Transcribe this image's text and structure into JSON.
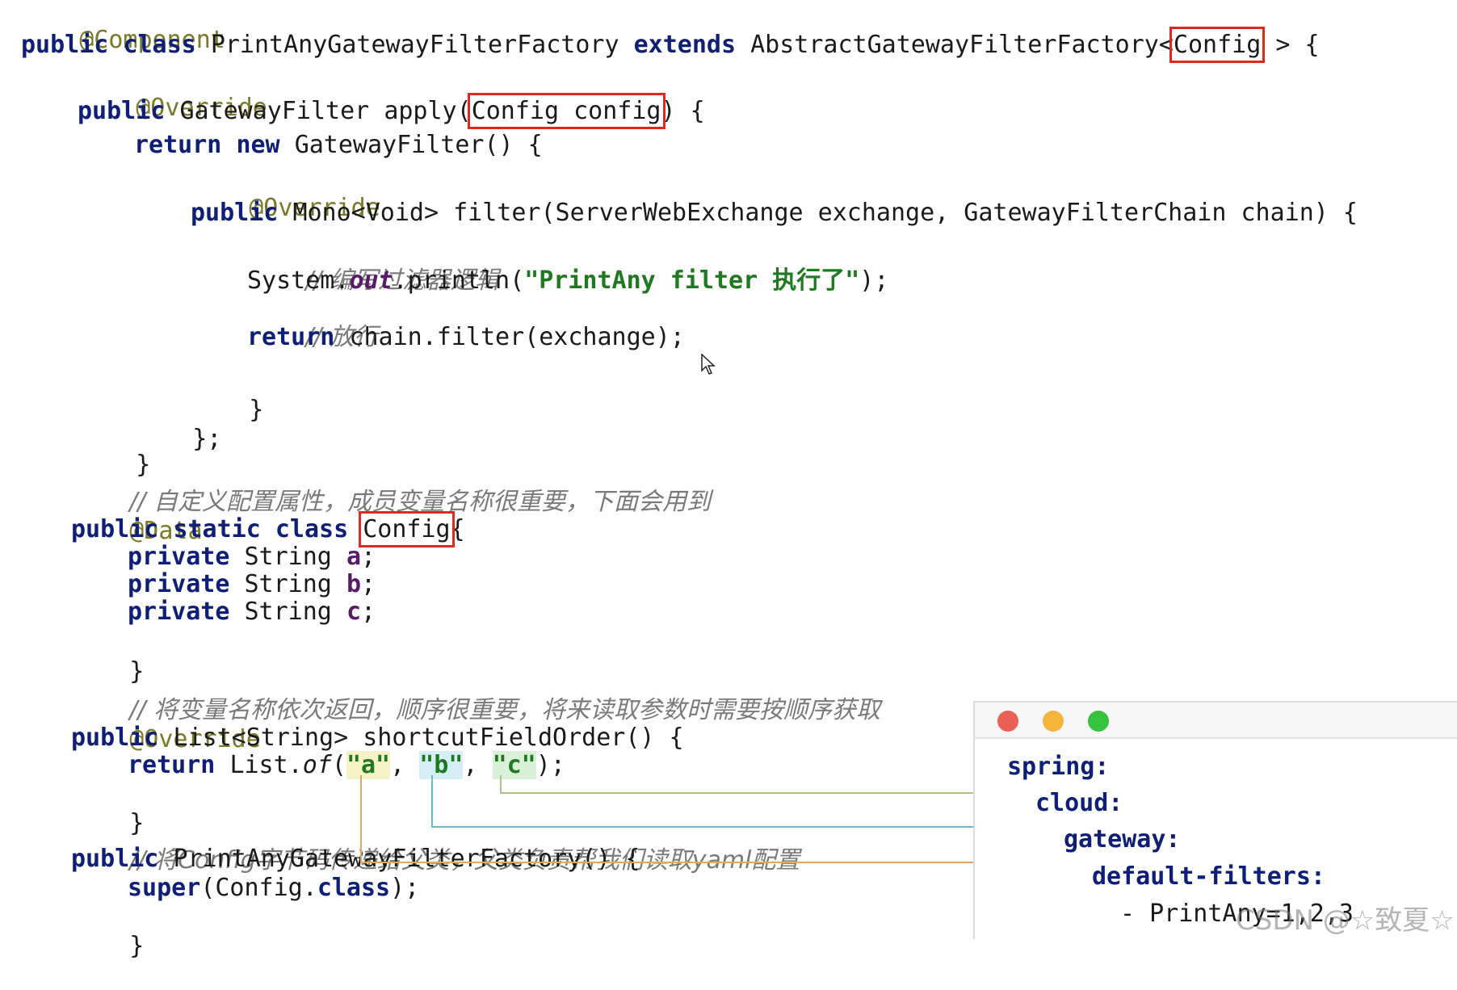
{
  "code": {
    "annotation_component": "@Component",
    "kw_public": "public",
    "kw_class": "class",
    "kw_extends": "extends",
    "kw_return": "return",
    "kw_new": "new",
    "kw_static": "static",
    "kw_private": "private",
    "kw_super": "super",
    "kw_class_lit": "class",
    "class_name": "PrintAnyGatewayFilterFactory",
    "parent_class": "AbstractGatewayFilterFactory<",
    "generic_config": "Config",
    "generic_close": " > {",
    "annotation_override": "@Override",
    "gateway_filter_type": "GatewayFilter",
    "apply_method": "apply(",
    "apply_param": "Config config",
    "apply_close": ") {",
    "new_gateway_filter": "GatewayFilter() {",
    "mono_void": "Mono<Void>",
    "filter_signature": "filter(ServerWebExchange exchange, GatewayFilterChain chain) {",
    "comment_filter_logic": "// 编写过滤器逻辑",
    "system_prefix": "System.",
    "system_out": "out",
    "println": ".println(",
    "println_string": "\"PrintAny filter 执行了\"",
    "println_end": ");",
    "comment_pass": "// 放行",
    "chain_filter": "chain.filter(exchange);",
    "close_brace": "}",
    "close_brace_semicolon": "};",
    "comment_config_props": "// 自定义配置属性，成员变量名称很重要，下面会用到",
    "annotation_data": "@Data",
    "inner_class_name": "Config",
    "open_brace": "{",
    "string_type": "String",
    "field_a": "a",
    "field_b": "b",
    "field_c": "c",
    "semicolon": ";",
    "comment_field_order": "// 将变量名称依次返回，顺序很重要，将来读取参数时需要按顺序获取",
    "list_string": "List<String>",
    "shortcut_method": "shortcutFieldOrder() {",
    "list_prefix": "List.",
    "list_of": "of",
    "paren_open": "(",
    "str_a": "\"a\"",
    "str_b": "\"b\"",
    "str_c": "\"c\"",
    "comma": ", ",
    "paren_close_semicolon": ");",
    "comment_super": "// 将Config字节码传递给父类，父类负责帮我们读取yaml配置",
    "constructor": "PrintAnyGatewayFilterFactory() {",
    "super_arg_open": "(Config.",
    "super_arg_close": ");"
  },
  "yaml": {
    "spring": "spring:",
    "cloud": "cloud:",
    "gateway": "gateway:",
    "default_filters": "default-filters:",
    "filter_entry": "- PrintAny=1,2,3"
  },
  "watermark": "CSDN @☆致夏☆",
  "colors": {
    "keyword": "#0f1f78",
    "annotation": "#7a7a28",
    "string": "#1f7a1f",
    "comment": "#7a7a7a",
    "highlight_box": "#e0281e",
    "line_a": "#e3a56a",
    "line_b": "#6fb6d0",
    "line_c": "#a8c48a",
    "traffic_red": "#ec5f56",
    "traffic_yellow": "#f5b53a",
    "traffic_green": "#35c23f"
  }
}
